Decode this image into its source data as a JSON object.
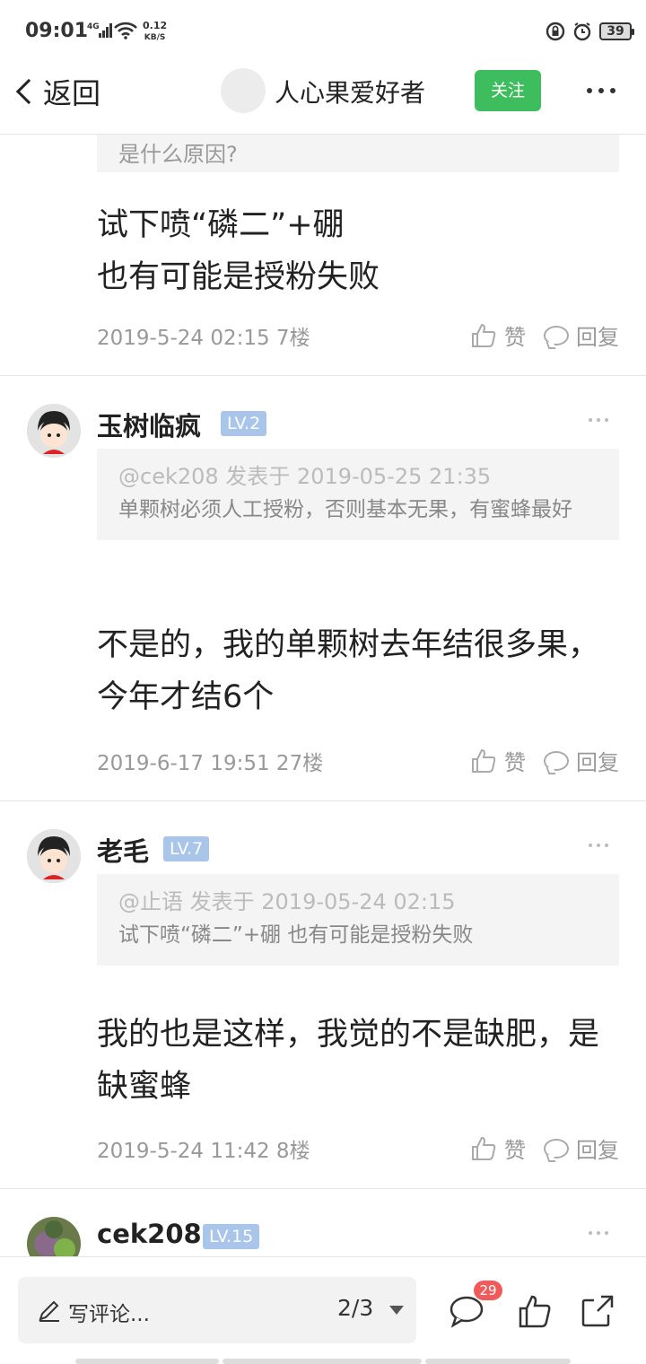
{
  "status_bar": {
    "time": "09:01",
    "network": "4G",
    "speed_value": "0.12",
    "speed_unit": "KB/S",
    "battery": "39"
  },
  "nav": {
    "back_label": "返回",
    "title": "人心果爱好者",
    "follow_label": "关注"
  },
  "posts": [
    {
      "partial_quote": "是什么原因?",
      "reply_lines": [
        "试下喷“磷二”+硼",
        "也有可能是授粉失败"
      ],
      "meta": "2019-5-24 02:15  7楼",
      "like_label": "赞",
      "reply_label": "回复"
    },
    {
      "username": "玉树临疯",
      "level": "LV.2",
      "quote_meta": "@cek208 发表于 2019-05-25 21:35",
      "quote_text": "单颗树必须人工授粉，否则基本无果，有蜜蜂最好",
      "reply": "不是的，我的单颗树去年结很多果，今年才结6个",
      "meta": "2019-6-17 19:51  27楼",
      "like_label": "赞",
      "reply_label": "回复"
    },
    {
      "username": "老毛",
      "level": "LV.7",
      "quote_meta": "@止语 发表于 2019-05-24 02:15",
      "quote_text": "试下喷“磷二”+硼 也有可能是授粉失败",
      "reply": "我的也是这样，我觉的不是缺肥，是缺蜜蜂",
      "meta": "2019-5-24 11:42  8楼",
      "like_label": "赞",
      "reply_label": "回复"
    },
    {
      "username": "cek208",
      "level": "LV.15"
    }
  ],
  "bottom_bar": {
    "comment_placeholder": "写评论...",
    "page_indicator": "2/3",
    "comment_count": "29"
  },
  "colors": {
    "follow_green": "#3dbd5d",
    "level_badge": "#a9c6ea",
    "notification_red": "#f05a5a"
  }
}
